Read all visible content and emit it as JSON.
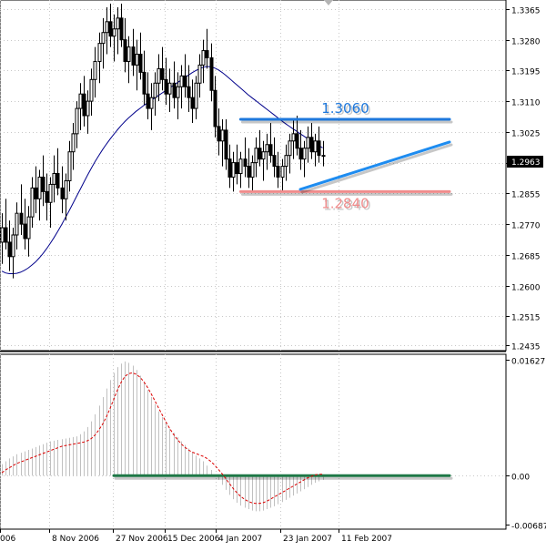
{
  "colors": {
    "background": "#ffffff",
    "frame": "#000000",
    "grid": "#c8c8c8",
    "candle": "#000000",
    "moving_average": "#00008b",
    "resistance": "#1e78dc",
    "support": "#f08c8c",
    "trendline": "#1e8cf0",
    "macd_histogram": "#c0c0c0",
    "signal_line": "#dc0000",
    "zero_line": "#1e7846",
    "price_marker_bg": "#000000",
    "price_marker_text": "#ffffff"
  },
  "chart_data": [
    {
      "type": "candlestick",
      "panel": "price",
      "y_ticks": [
        "1.3365",
        "1.3280",
        "1.3195",
        "1.3110",
        "1.3025",
        "1.2940",
        "1.2855",
        "1.2770",
        "1.2685",
        "1.2600",
        "1.2515",
        "1.2435"
      ],
      "ylim": [
        1.242,
        1.339
      ],
      "x_ticks": [
        "006",
        "8 Nov 2006",
        "27 Nov 2006",
        "15 Dec 2006",
        "4 Jan 2007",
        "23 Jan 2007",
        "11 Feb 2007"
      ],
      "current_price": "1.2963",
      "candles": [
        [
          1.272,
          1.28,
          1.266,
          1.276
        ],
        [
          1.276,
          1.284,
          1.27,
          1.272
        ],
        [
          1.272,
          1.278,
          1.264,
          1.268
        ],
        [
          1.268,
          1.276,
          1.262,
          1.274
        ],
        [
          1.274,
          1.283,
          1.27,
          1.28
        ],
        [
          1.28,
          1.288,
          1.274,
          1.277
        ],
        [
          1.277,
          1.284,
          1.27,
          1.273
        ],
        [
          1.273,
          1.282,
          1.268,
          1.279
        ],
        [
          1.279,
          1.29,
          1.276,
          1.287
        ],
        [
          1.287,
          1.293,
          1.28,
          1.284
        ],
        [
          1.284,
          1.292,
          1.278,
          1.29
        ],
        [
          1.29,
          1.296,
          1.282,
          1.286
        ],
        [
          1.286,
          1.291,
          1.278,
          1.283
        ],
        [
          1.283,
          1.29,
          1.276,
          1.288
        ],
        [
          1.288,
          1.296,
          1.283,
          1.291
        ],
        [
          1.291,
          1.298,
          1.285,
          1.287
        ],
        [
          1.287,
          1.293,
          1.28,
          1.284
        ],
        [
          1.284,
          1.291,
          1.278,
          1.289
        ],
        [
          1.289,
          1.3,
          1.286,
          1.297
        ],
        [
          1.297,
          1.305,
          1.292,
          1.302
        ],
        [
          1.302,
          1.311,
          1.298,
          1.309
        ],
        [
          1.309,
          1.316,
          1.303,
          1.313
        ],
        [
          1.313,
          1.318,
          1.304,
          1.307
        ],
        [
          1.307,
          1.314,
          1.302,
          1.311
        ],
        [
          1.311,
          1.32,
          1.307,
          1.317
        ],
        [
          1.317,
          1.326,
          1.312,
          1.322
        ],
        [
          1.322,
          1.33,
          1.316,
          1.327
        ],
        [
          1.327,
          1.334,
          1.32,
          1.33
        ],
        [
          1.33,
          1.337,
          1.324,
          1.333
        ],
        [
          1.333,
          1.338,
          1.326,
          1.329
        ],
        [
          1.329,
          1.335,
          1.322,
          1.331
        ],
        [
          1.331,
          1.337,
          1.324,
          1.334
        ],
        [
          1.334,
          1.338,
          1.326,
          1.328
        ],
        [
          1.328,
          1.334,
          1.319,
          1.322
        ],
        [
          1.322,
          1.329,
          1.316,
          1.326
        ],
        [
          1.326,
          1.331,
          1.318,
          1.321
        ],
        [
          1.321,
          1.328,
          1.314,
          1.324
        ],
        [
          1.324,
          1.33,
          1.317,
          1.319
        ],
        [
          1.319,
          1.325,
          1.31,
          1.313
        ],
        [
          1.313,
          1.319,
          1.306,
          1.309
        ],
        [
          1.309,
          1.316,
          1.303,
          1.312
        ],
        [
          1.312,
          1.319,
          1.307,
          1.316
        ],
        [
          1.316,
          1.324,
          1.311,
          1.32
        ],
        [
          1.32,
          1.326,
          1.314,
          1.317
        ],
        [
          1.317,
          1.323,
          1.31,
          1.313
        ],
        [
          1.313,
          1.32,
          1.308,
          1.316
        ],
        [
          1.316,
          1.322,
          1.309,
          1.312
        ],
        [
          1.312,
          1.319,
          1.306,
          1.315
        ],
        [
          1.315,
          1.321,
          1.309,
          1.318
        ],
        [
          1.318,
          1.324,
          1.312,
          1.315
        ],
        [
          1.315,
          1.321,
          1.308,
          1.312
        ],
        [
          1.312,
          1.317,
          1.305,
          1.309
        ],
        [
          1.309,
          1.318,
          1.306,
          1.316
        ],
        [
          1.316,
          1.324,
          1.312,
          1.321
        ],
        [
          1.321,
          1.328,
          1.316,
          1.325
        ],
        [
          1.325,
          1.331,
          1.32,
          1.323
        ],
        [
          1.323,
          1.327,
          1.311,
          1.314
        ],
        [
          1.314,
          1.318,
          1.301,
          1.304
        ],
        [
          1.304,
          1.309,
          1.296,
          1.3
        ],
        [
          1.3,
          1.306,
          1.293,
          1.303
        ],
        [
          1.303,
          1.306,
          1.292,
          1.295
        ],
        [
          1.295,
          1.299,
          1.287,
          1.29
        ],
        [
          1.29,
          1.297,
          1.286,
          1.294
        ],
        [
          1.294,
          1.299,
          1.288,
          1.291
        ],
        [
          1.291,
          1.297,
          1.287,
          1.295
        ],
        [
          1.295,
          1.301,
          1.29,
          1.293
        ],
        [
          1.293,
          1.298,
          1.287,
          1.29
        ],
        [
          1.29,
          1.296,
          1.286,
          1.294
        ],
        [
          1.294,
          1.301,
          1.29,
          1.298
        ],
        [
          1.298,
          1.303,
          1.293,
          1.295
        ],
        [
          1.295,
          1.3,
          1.289,
          1.297
        ],
        [
          1.297,
          1.302,
          1.292,
          1.299
        ],
        [
          1.299,
          1.305,
          1.294,
          1.296
        ],
        [
          1.296,
          1.301,
          1.29,
          1.293
        ],
        [
          1.293,
          1.297,
          1.287,
          1.29
        ],
        [
          1.29,
          1.295,
          1.286,
          1.293
        ],
        [
          1.293,
          1.299,
          1.289,
          1.296
        ],
        [
          1.296,
          1.302,
          1.291,
          1.3
        ],
        [
          1.3,
          1.306,
          1.295,
          1.302
        ],
        [
          1.302,
          1.307,
          1.296,
          1.298
        ],
        [
          1.298,
          1.303,
          1.292,
          1.295
        ],
        [
          1.295,
          1.3,
          1.29,
          1.298
        ],
        [
          1.298,
          1.304,
          1.294,
          1.301
        ],
        [
          1.301,
          1.305,
          1.295,
          1.297
        ],
        [
          1.297,
          1.302,
          1.293,
          1.3
        ],
        [
          1.3,
          1.304,
          1.294,
          1.296
        ],
        [
          1.296,
          1.3,
          1.293,
          1.296
        ]
      ],
      "moving_average": [
        1.264,
        1.2635,
        1.2633,
        1.2633,
        1.2634,
        1.2637,
        1.2642,
        1.2648,
        1.2656,
        1.2665,
        1.2676,
        1.2688,
        1.2702,
        1.2717,
        1.2733,
        1.275,
        1.2768,
        1.2787,
        1.2806,
        1.2826,
        1.2846,
        1.2866,
        1.2886,
        1.2906,
        1.2925,
        1.2943,
        1.296,
        1.2976,
        1.2991,
        1.3005,
        1.3018,
        1.3031,
        1.3043,
        1.3054,
        1.3064,
        1.3073,
        1.3082,
        1.309,
        1.3098,
        1.3105,
        1.3112,
        1.3119,
        1.3126,
        1.3133,
        1.314,
        1.3147,
        1.3154,
        1.3161,
        1.3168,
        1.3175,
        1.3182,
        1.3189,
        1.3195,
        1.32,
        1.3204,
        1.3206,
        1.3205,
        1.3202,
        1.3197,
        1.319,
        1.3182,
        1.3173,
        1.3164,
        1.3155,
        1.3146,
        1.3137,
        1.3128,
        1.312,
        1.3112,
        1.3104,
        1.3096,
        1.3088,
        1.308,
        1.3072,
        1.3064,
        1.3056,
        1.3048,
        1.3041,
        1.3034,
        1.3027,
        1.302,
        1.3013,
        1.3006,
        1.2999,
        1.2993,
        1.2987,
        1.2981
      ],
      "annotations": [
        {
          "label": "1.3060",
          "price": 1.306,
          "kind": "resistance",
          "from_bar": 64,
          "to_bar": 120
        },
        {
          "label": "1.2840",
          "price": 1.286,
          "kind": "support",
          "from_bar": 64,
          "to_bar": 120
        },
        {
          "kind": "trendline",
          "from": [
            80,
            1.2866
          ],
          "to": [
            120,
            1.2997
          ]
        }
      ]
    },
    {
      "type": "histogram",
      "panel": "indicator",
      "y_ticks": [
        "0.01627",
        "0.00",
        "-0.00687"
      ],
      "ylim": [
        -0.0075,
        0.017
      ],
      "histogram": [
        0.0016,
        0.002,
        0.0024,
        0.0027,
        0.003,
        0.0032,
        0.0034,
        0.0036,
        0.0038,
        0.004,
        0.0042,
        0.0044,
        0.0046,
        0.0048,
        0.0049,
        0.005,
        0.0051,
        0.0052,
        0.0053,
        0.0054,
        0.0055,
        0.0058,
        0.0062,
        0.0068,
        0.0076,
        0.0086,
        0.0098,
        0.011,
        0.0122,
        0.0134,
        0.0144,
        0.0152,
        0.0157,
        0.016,
        0.0158,
        0.0154,
        0.0148,
        0.014,
        0.013,
        0.012,
        0.011,
        0.01,
        0.009,
        0.0082,
        0.0074,
        0.0066,
        0.006,
        0.0054,
        0.0048,
        0.0043,
        0.0038,
        0.0033,
        0.0028,
        0.0024,
        0.002,
        0.0014,
        0.0008,
        0.0001,
        -0.0006,
        -0.0013,
        -0.002,
        -0.0027,
        -0.0033,
        -0.0038,
        -0.0042,
        -0.0045,
        -0.0047,
        -0.0049,
        -0.005,
        -0.005,
        -0.0049,
        -0.0047,
        -0.0045,
        -0.0043,
        -0.004,
        -0.0037,
        -0.0034,
        -0.0031,
        -0.0028,
        -0.0025,
        -0.0022,
        -0.0019,
        -0.0016,
        -0.0013,
        -0.001,
        -0.0008,
        -0.0006
      ],
      "signal": [
        0.0004,
        0.0008,
        0.0011,
        0.0014,
        0.0017,
        0.0019,
        0.0021,
        0.0023,
        0.0025,
        0.0027,
        0.0029,
        0.0031,
        0.0033,
        0.0035,
        0.0037,
        0.0039,
        0.0041,
        0.0042,
        0.0043,
        0.0044,
        0.0045,
        0.0046,
        0.0047,
        0.0049,
        0.0052,
        0.0057,
        0.0064,
        0.0072,
        0.0082,
        0.0094,
        0.0107,
        0.012,
        0.0131,
        0.0139,
        0.0143,
        0.0144,
        0.0142,
        0.0138,
        0.0132,
        0.0124,
        0.0115,
        0.0105,
        0.0095,
        0.0085,
        0.0075,
        0.0066,
        0.0058,
        0.0051,
        0.0045,
        0.004,
        0.0036,
        0.0033,
        0.0031,
        0.0029,
        0.0027,
        0.0024,
        0.002,
        0.0015,
        0.0009,
        0.0003,
        -0.0004,
        -0.0011,
        -0.0018,
        -0.0024,
        -0.0029,
        -0.0033,
        -0.0036,
        -0.0038,
        -0.0039,
        -0.0039,
        -0.0038,
        -0.0036,
        -0.0033,
        -0.003,
        -0.0027,
        -0.0024,
        -0.0021,
        -0.0018,
        -0.0015,
        -0.0012,
        -0.0009,
        -0.0006,
        -0.0003,
        -0.0001,
        0.0001,
        0.0002,
        0.0002
      ],
      "zero_line": {
        "label": "0.00",
        "from_bar": 30,
        "to_bar": 120
      }
    }
  ]
}
